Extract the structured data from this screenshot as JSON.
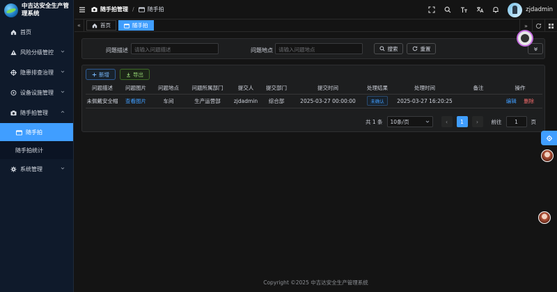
{
  "brand": {
    "title": "中吉达安全生产管理系统"
  },
  "sidebar": {
    "items": [
      {
        "label": "首页",
        "icon": "home-icon"
      },
      {
        "label": "风险分级管控",
        "icon": "warning-icon"
      },
      {
        "label": "隐患排查治理",
        "icon": "target-icon"
      },
      {
        "label": "设备设施管理",
        "icon": "settings-circle-icon"
      },
      {
        "label": "随手拍管理",
        "icon": "camera-icon"
      },
      {
        "label": "系统管理",
        "icon": "gear-icon"
      }
    ],
    "sub_items": [
      {
        "label": "随手拍",
        "icon": "camera-icon",
        "active": true
      },
      {
        "label": "随手拍统计",
        "active": false
      }
    ]
  },
  "header": {
    "crumb_parent": "随手拍管理",
    "crumb_sep": "/",
    "crumb_current": "随手拍",
    "username": "zjdadmin"
  },
  "tabs": [
    {
      "label": "首页",
      "icon": "home-icon",
      "active": false
    },
    {
      "label": "随手拍",
      "icon": "camera-icon",
      "active": true
    }
  ],
  "search": {
    "desc_label": "问题描述",
    "desc_placeholder": "请输入问题描述",
    "loc_label": "问题地点",
    "loc_placeholder": "请输入问题地点",
    "search_btn": "搜索",
    "reset_btn": "重置"
  },
  "toolbar": {
    "add": "新增",
    "export": "导出"
  },
  "table": {
    "columns": [
      "问题描述",
      "问题图片",
      "问题地点",
      "问题所属部门",
      "提交人",
      "提交部门",
      "提交时间",
      "处理结果",
      "处理时间",
      "备注",
      "操作"
    ],
    "rows": [
      {
        "desc": "未佩戴安全帽",
        "image": "查看图片",
        "location": "车间",
        "dept": "生产运营部",
        "submitter": "zjdadmin",
        "submit_dept": "综合部",
        "submit_time": "2025-03-27 00:00:00",
        "result": "未确认",
        "handle_time": "2025-03-27 16:20:25",
        "remark": "",
        "edit": "编辑",
        "delete": "删除"
      }
    ]
  },
  "pager": {
    "total": "共 1 条",
    "page_size": "10条/页",
    "current": "1",
    "goto_label": "前往",
    "goto_value": "1",
    "page_suffix": "页"
  },
  "footer": {
    "text": "Copyright ©2025 中吉达安全生产管理系统"
  },
  "colors": {
    "accent": "#409eff",
    "danger": "#f56c6c",
    "success": "#95d475",
    "sidebar_bg": "#0f1a2b"
  }
}
